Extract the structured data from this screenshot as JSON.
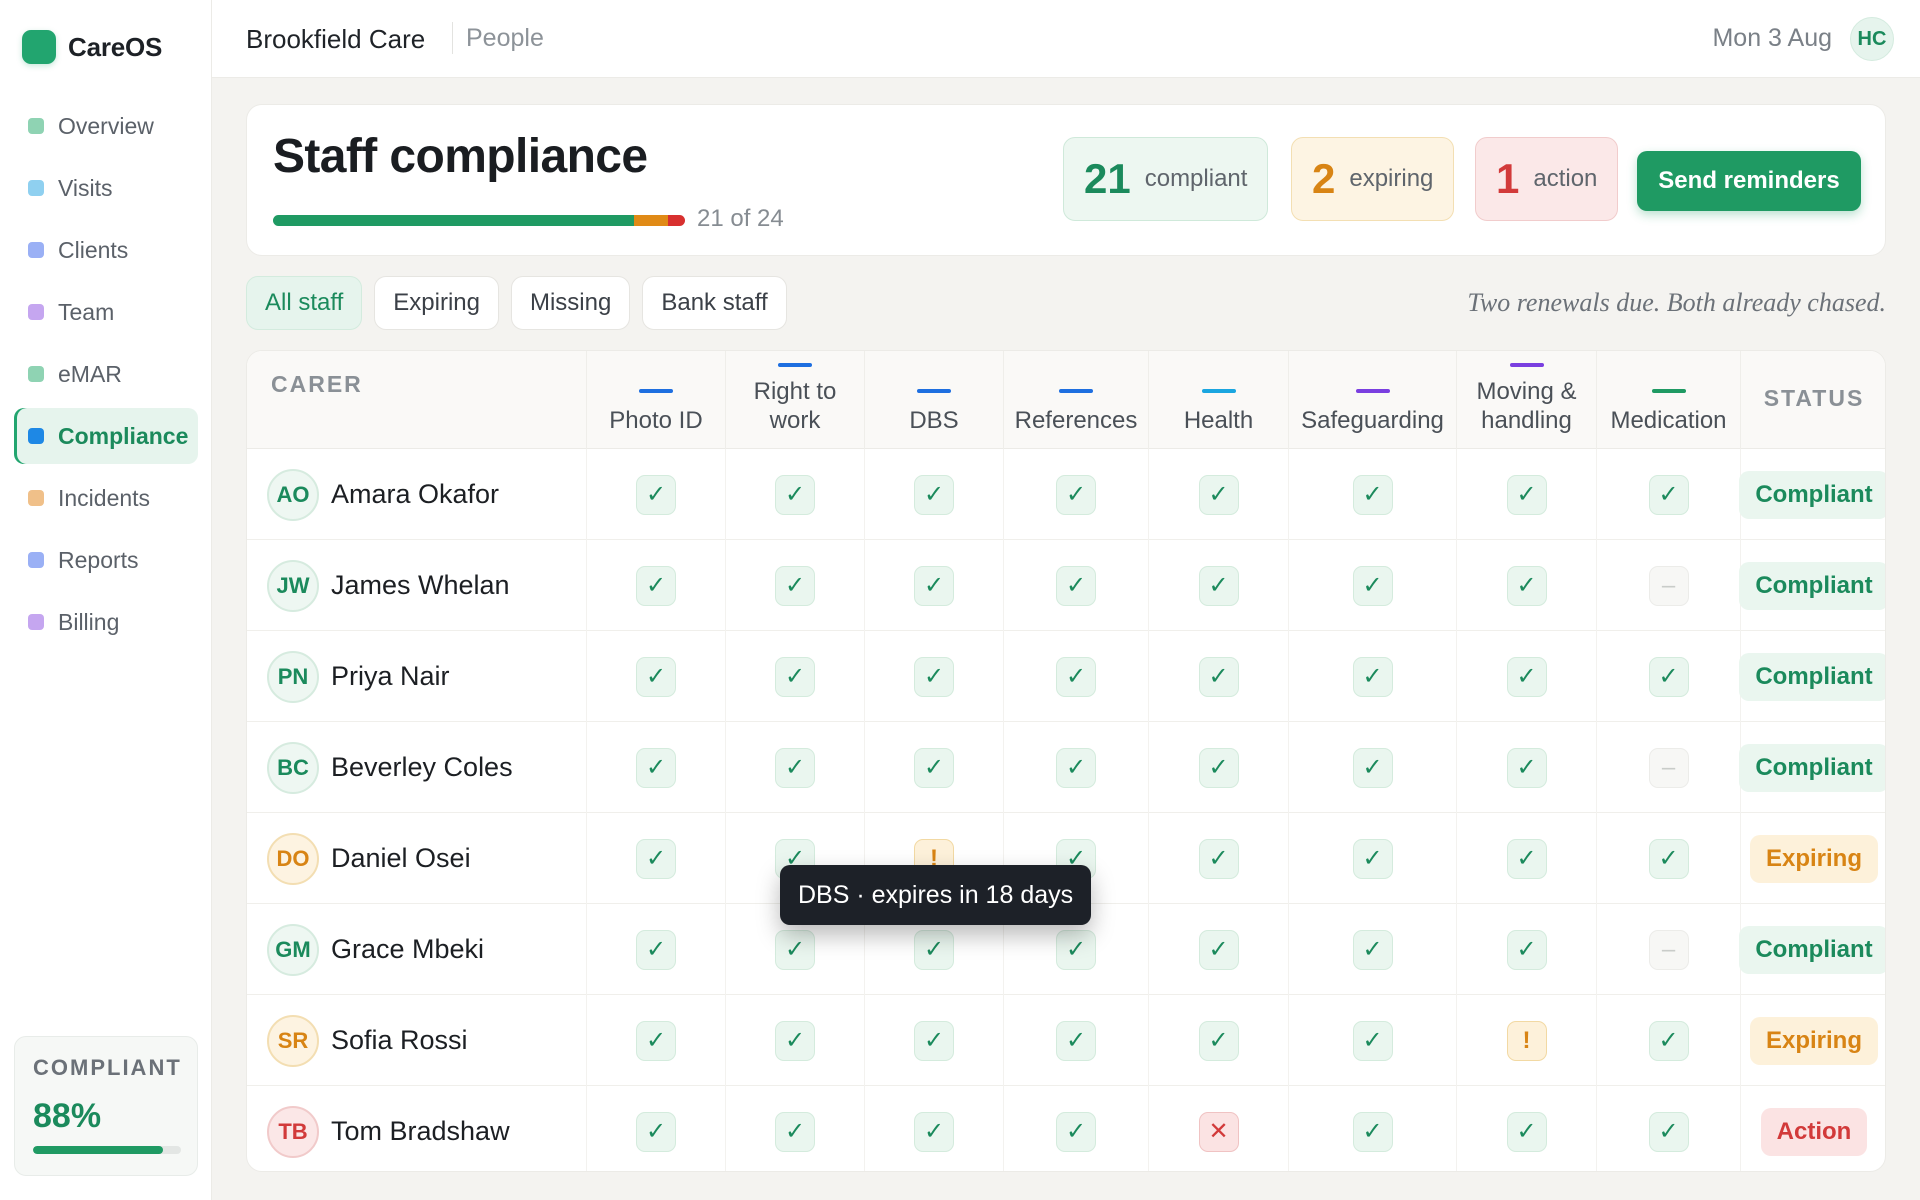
{
  "app": {
    "name": "CareOS"
  },
  "sidebar": {
    "items": [
      {
        "label": "Overview",
        "color": "#8fd3b3",
        "active": false
      },
      {
        "label": "Visits",
        "color": "#8fd0f0",
        "active": false
      },
      {
        "label": "Clients",
        "color": "#9ab0f5",
        "active": false
      },
      {
        "label": "Team",
        "color": "#c5a6f0",
        "active": false
      },
      {
        "label": "eMAR",
        "color": "#8fd3b3",
        "active": false
      },
      {
        "label": "Compliance",
        "color": "#1e88e5",
        "active": true
      },
      {
        "label": "Incidents",
        "color": "#f0c089",
        "active": false
      },
      {
        "label": "Reports",
        "color": "#9ab0f5",
        "active": false
      },
      {
        "label": "Billing",
        "color": "#c5a6f0",
        "active": false
      }
    ],
    "summary": {
      "label": "COMPLIANT",
      "value": "88%",
      "fraction": 0.88
    }
  },
  "topbar": {
    "org": "Brookfield Care",
    "page": "People",
    "date": "Mon 3 Aug",
    "user_initials": "HC"
  },
  "header": {
    "title": "Staff compliance",
    "progress": {
      "text": "21 of 24",
      "compliant": 21,
      "expiring": 2,
      "action": 1,
      "total": 24
    },
    "stats": [
      {
        "kind": "ok",
        "value": "21",
        "label": "compliant"
      },
      {
        "kind": "warn",
        "value": "2",
        "label": "expiring"
      },
      {
        "kind": "bad",
        "value": "1",
        "label": "action"
      }
    ],
    "primary_button": "Send reminders"
  },
  "filters": {
    "chips": [
      {
        "label": "All staff",
        "active": true
      },
      {
        "label": "Expiring",
        "active": false
      },
      {
        "label": "Missing",
        "active": false
      },
      {
        "label": "Bank staff",
        "active": false
      }
    ],
    "note": "Two renewals due. Both already chased."
  },
  "table": {
    "carer_header": "CARER",
    "status_header": "STATUS",
    "columns": [
      {
        "key": "photo_id",
        "label": "Photo ID",
        "color": "#1e6fe0"
      },
      {
        "key": "right_to_work",
        "label": "Right to work",
        "color": "#1e6fe0"
      },
      {
        "key": "dbs",
        "label": "DBS",
        "color": "#1e6fe0"
      },
      {
        "key": "references",
        "label": "References",
        "color": "#1e6fe0"
      },
      {
        "key": "health",
        "label": "Health",
        "color": "#1aa6e0"
      },
      {
        "key": "safeguarding",
        "label": "Safeguarding",
        "color": "#7a3fe0"
      },
      {
        "key": "moving_handling",
        "label": "Moving & handling",
        "color": "#7a3fe0"
      },
      {
        "key": "medication",
        "label": "Medication",
        "color": "#1f9a63"
      }
    ],
    "rows": [
      {
        "initials": "AO",
        "name": "Amara Okafor",
        "status": "Compliant",
        "kind": "ok",
        "checks": [
          "ok",
          "ok",
          "ok",
          "ok",
          "ok",
          "ok",
          "ok",
          "ok"
        ]
      },
      {
        "initials": "JW",
        "name": "James Whelan",
        "status": "Compliant",
        "kind": "ok",
        "checks": [
          "ok",
          "ok",
          "ok",
          "ok",
          "ok",
          "ok",
          "ok",
          "na"
        ]
      },
      {
        "initials": "PN",
        "name": "Priya Nair",
        "status": "Compliant",
        "kind": "ok",
        "checks": [
          "ok",
          "ok",
          "ok",
          "ok",
          "ok",
          "ok",
          "ok",
          "ok"
        ]
      },
      {
        "initials": "BC",
        "name": "Beverley Coles",
        "status": "Compliant",
        "kind": "ok",
        "checks": [
          "ok",
          "ok",
          "ok",
          "ok",
          "ok",
          "ok",
          "ok",
          "na"
        ]
      },
      {
        "initials": "DO",
        "name": "Daniel Osei",
        "status": "Expiring",
        "kind": "warn",
        "checks": [
          "ok",
          "ok",
          "warn",
          "ok",
          "ok",
          "ok",
          "ok",
          "ok"
        ]
      },
      {
        "initials": "GM",
        "name": "Grace Mbeki",
        "status": "Compliant",
        "kind": "ok",
        "checks": [
          "ok",
          "ok",
          "ok",
          "ok",
          "ok",
          "ok",
          "ok",
          "na"
        ]
      },
      {
        "initials": "SR",
        "name": "Sofia Rossi",
        "status": "Expiring",
        "kind": "warn",
        "checks": [
          "ok",
          "ok",
          "ok",
          "ok",
          "ok",
          "ok",
          "warn",
          "ok"
        ]
      },
      {
        "initials": "TB",
        "name": "Tom Bradshaw",
        "status": "Action",
        "kind": "bad",
        "checks": [
          "ok",
          "ok",
          "ok",
          "ok",
          "bad",
          "ok",
          "ok",
          "ok"
        ]
      }
    ],
    "symbols": {
      "ok": "✓",
      "warn": "!",
      "bad": "✕",
      "na": "–"
    }
  },
  "tooltip": {
    "text": "DBS · expires in 18 days"
  }
}
